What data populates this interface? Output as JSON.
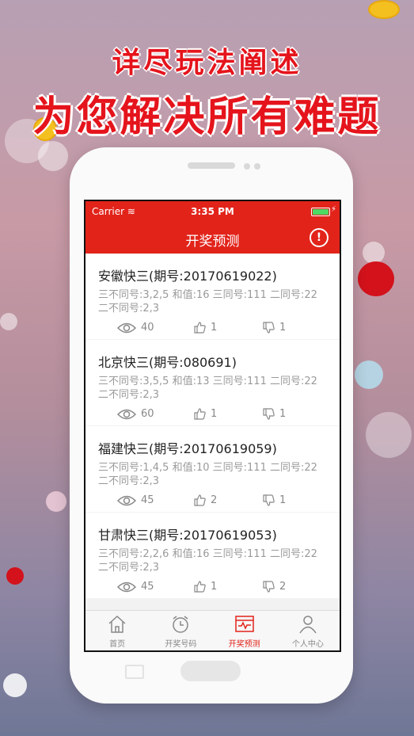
{
  "promo": {
    "headline1": "详尽玩法阐述",
    "headline2": "为您解决所有难题"
  },
  "status_bar": {
    "carrier": "Carrier",
    "time": "3:35 PM"
  },
  "nav": {
    "title": "开奖预测"
  },
  "items": [
    {
      "title": "安徽快三(期号:20170619022)",
      "desc": "三不同号:3,2,5 和值:16 三同号:111 二同号:22 二不同号:2,3",
      "views": "40",
      "likes": "1",
      "dislikes": "1"
    },
    {
      "title": "北京快三(期号:080691)",
      "desc": "三不同号:3,5,5 和值:13 三同号:111 二同号:22 二不同号:2,3",
      "views": "60",
      "likes": "1",
      "dislikes": "1"
    },
    {
      "title": "福建快三(期号:20170619059)",
      "desc": "三不同号:1,4,5 和值:10 三同号:111 二同号:22 二不同号:2,3",
      "views": "45",
      "likes": "2",
      "dislikes": "1"
    },
    {
      "title": "甘肃快三(期号:20170619053)",
      "desc": "三不同号:2,2,6 和值:16 三同号:111 二同号:22 二不同号:2,3",
      "views": "45",
      "likes": "1",
      "dislikes": "2"
    }
  ],
  "tabs": [
    {
      "label": "首页",
      "icon": "home-icon"
    },
    {
      "label": "开奖号码",
      "icon": "alarm-clock-icon"
    },
    {
      "label": "开奖预测",
      "icon": "chart-screen-icon",
      "active": true
    },
    {
      "label": "个人中心",
      "icon": "person-icon"
    }
  ],
  "colors": {
    "brand_red": "#e2231a",
    "headline_red": "#e5141c"
  }
}
